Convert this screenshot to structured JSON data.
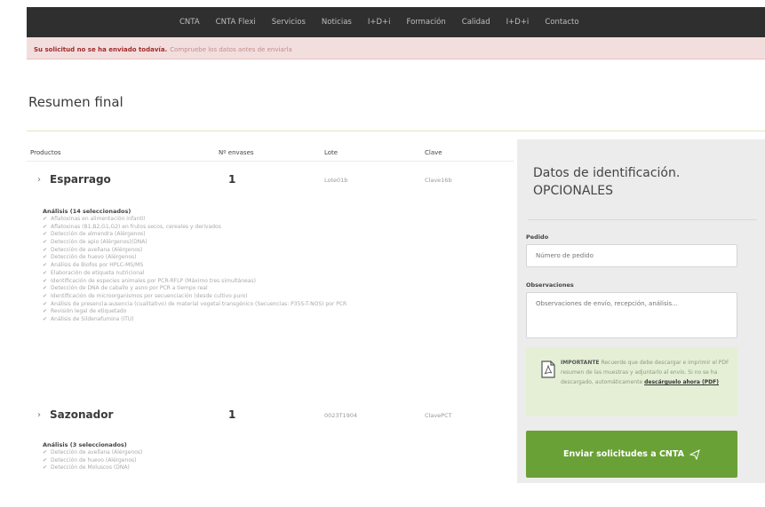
{
  "nav": [
    "CNTA",
    "CNTA Flexi",
    "Servicios",
    "Noticias",
    "I+D+i",
    "Formación",
    "Calidad",
    "I+D+i",
    "Contacto"
  ],
  "alert": {
    "strong": "Su solicitud no se ha enviado todavía.",
    "rest": "Compruebe los datos antes de enviarla"
  },
  "page_title": "Resumen final",
  "table": {
    "headers": [
      "Productos",
      "Nº envases",
      "Lote",
      "Clave"
    ]
  },
  "products": [
    {
      "name": "Esparrago",
      "qty": "1",
      "lote": "Lote01b",
      "clave": "Clave16b",
      "analysis_title": "Análisis (14 seleccionados)",
      "analyses": [
        "Aflatoxinas en alimentación infantil",
        "Aflatoxinas (B1,B2,G1,G2) en frutos secos, cereales y derivados",
        "Detección de almendra (Alérgenos)",
        "Detección de apio (Alérgenos)(DNA)",
        "Detección de avellana (Alérgenos)",
        "Detección de huevo (Alérgenos)",
        "Análisis de Biofos por HPLC-MS/MS",
        "Elaboración de etiqueta nutricional",
        "Identificación de especies animales por PCR-RFLP (Máximo tres simultáneas)",
        "Detección de DNA de caballo y asno por PCR a tiempo real",
        "Identificación de microorganismos por secuenciación (desde cultivo puro)",
        "Análisis de presencia-ausencia (cualitativo) de material vegetal transgénico (Secuencias: P35S-T-NOS) por PCR",
        "Revisión legal de etiquetado",
        "Análisis de Sildenafumina (ITU)"
      ]
    },
    {
      "name": "Sazonador",
      "qty": "1",
      "lote": "0023T1904",
      "clave": "ClavePCT",
      "analysis_title": "Análisis (3 seleccionados)",
      "analyses": [
        "Detección de avellana (Alérgenos)",
        "Detección de huevo (Alérgenos)",
        "Detección de Moluscos (DNA)"
      ]
    }
  ],
  "sidebar": {
    "title_line1": "Datos de identificación.",
    "title_line2": "OPCIONALES",
    "pedido_label": "Pedido",
    "pedido_placeholder": "Número de pedido",
    "obs_label": "Observaciones",
    "obs_placeholder": "Observaciones de envío, recepción, análisis...",
    "note_strong": "IMPORTANTE",
    "note_text": "Recuerde que debe descargar e imprimir el PDF resumen de las muestras y adjuntarlo al envío. Si no se ha descargado, automáticamente",
    "note_link": "descárguelo ahora (PDF)",
    "submit": "Enviar solicitudes a CNTA",
    "send_icon": "paper-plane-icon"
  },
  "colors": {
    "nav_bg": "#2f2f2f",
    "alert_bg": "#f3dede",
    "accent": "#6aa136",
    "sidebar_bg": "#ececec"
  }
}
